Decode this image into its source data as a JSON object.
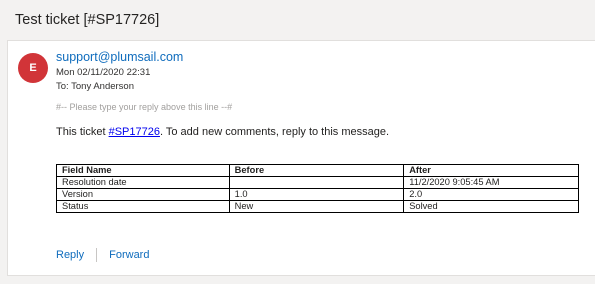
{
  "subject": "Test ticket [#SP17726]",
  "email": {
    "avatar_letter": "E",
    "avatar_color": "#d13438",
    "sender": "support@plumsail.com",
    "date": "Mon 02/11/2020 22:31",
    "to": "To: Tony Anderson",
    "separator": "#-- Please type your reply above this line --#",
    "message_prefix": "This ticket ",
    "ticket_link": "#SP17726",
    "message_suffix": ". To add new comments, reply to this message."
  },
  "table": {
    "headers": [
      "Field Name",
      "Before",
      "After"
    ],
    "rows": [
      [
        "Resolution date",
        "",
        "11/2/2020 9:05:45 AM"
      ],
      [
        "Version",
        "1.0",
        "2.0"
      ],
      [
        "Status",
        "New",
        "Solved"
      ]
    ]
  },
  "actions": {
    "reply": "Reply",
    "forward": "Forward"
  },
  "colors": {
    "link": "#0f6cbd",
    "background": "#f3f2f1"
  }
}
